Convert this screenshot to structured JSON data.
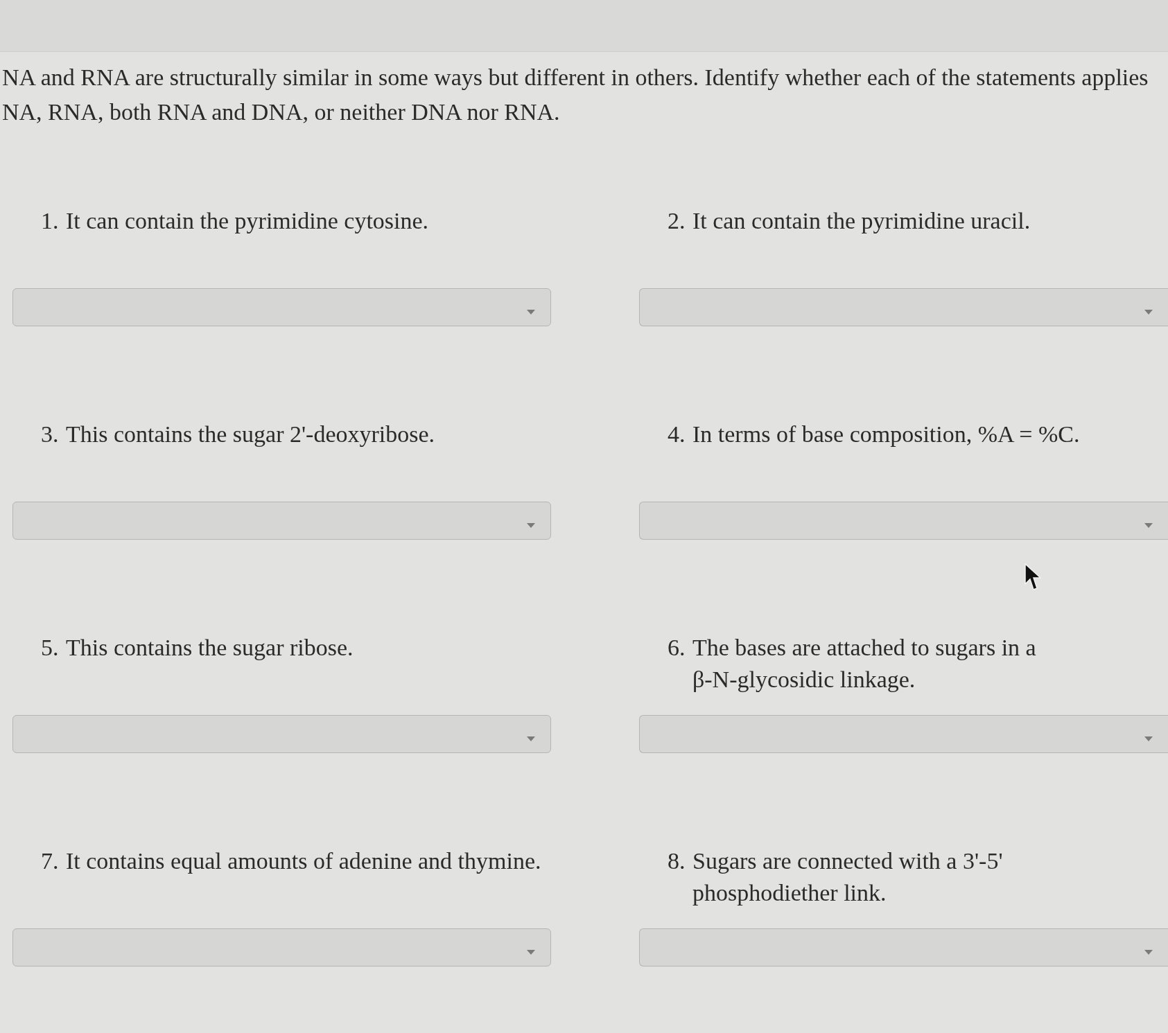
{
  "instructions": {
    "lines": [
      "NA and RNA are structurally similar in some ways but different in others. Identify whether each of the statements applies",
      "NA, RNA, both RNA and DNA, or neither DNA nor RNA."
    ]
  },
  "questions": [
    {
      "number": "1.",
      "text": "It can contain the pyrimidine cytosine.",
      "kind": "dropdown"
    },
    {
      "number": "2.",
      "text": "It can contain the pyrimidine uracil.",
      "kind": "dropdown"
    },
    {
      "number": "3.",
      "text": "This contains the sugar 2'-deoxyribose.",
      "kind": "dropdown"
    },
    {
      "number": "4.",
      "text": "In terms of base composition, %A = %C.",
      "kind": "dropdown"
    },
    {
      "number": "5.",
      "text": "This contains the sugar ribose.",
      "kind": "dropdown"
    },
    {
      "number": "6.",
      "text": "The bases are attached to sugars in a β-N-glycosidic linkage.",
      "kind": "dropdown"
    },
    {
      "number": "7.",
      "text": "It contains equal amounts of adenine and thymine.",
      "kind": "dropdown"
    },
    {
      "number": "8.",
      "text": "Sugars are connected with a 3'-5' phosphodiether link.",
      "kind": "dropdown"
    }
  ]
}
